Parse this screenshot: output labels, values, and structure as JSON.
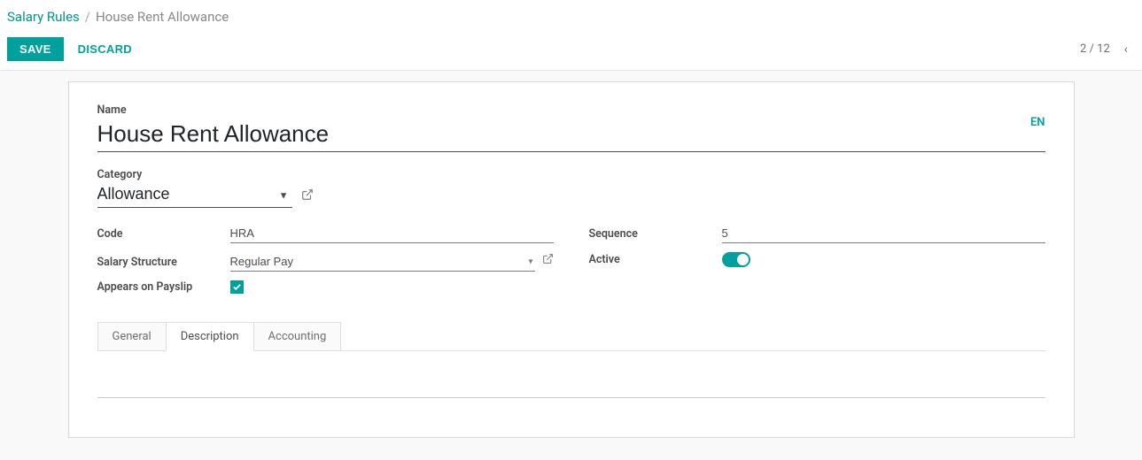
{
  "breadcrumb": {
    "root": "Salary Rules",
    "sep": "/",
    "current": "House Rent Allowance"
  },
  "actions": {
    "save": "SAVE",
    "discard": "DISCARD"
  },
  "pager": {
    "text": "2 / 12"
  },
  "lang": "EN",
  "fields": {
    "name_label": "Name",
    "name_value": "House Rent Allowance",
    "category_label": "Category",
    "category_value": "Allowance",
    "code_label": "Code",
    "code_value": "HRA",
    "structure_label": "Salary Structure",
    "structure_value": "Regular Pay",
    "payslip_label": "Appears on Payslip",
    "sequence_label": "Sequence",
    "sequence_value": "5",
    "active_label": "Active"
  },
  "tabs": {
    "general": "General",
    "description": "Description",
    "accounting": "Accounting"
  },
  "description_value": ""
}
